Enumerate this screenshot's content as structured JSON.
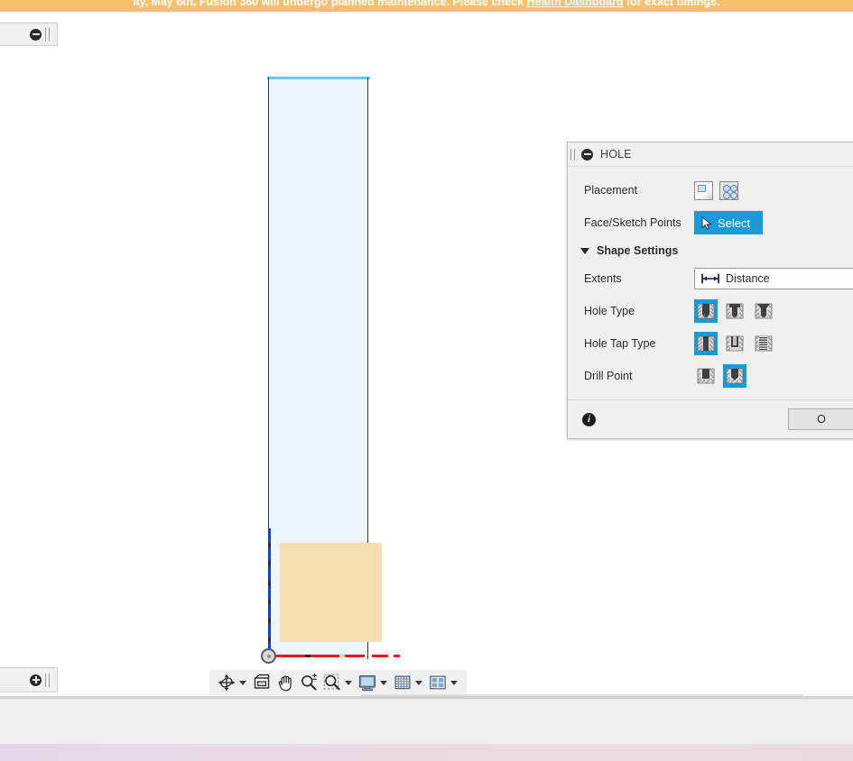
{
  "banner": {
    "text_before": "ay, May 6th, Fusion 360 will undergo planned maintenance. Please check ",
    "link_label": "Health Dashboard",
    "text_after": " for exact timings.",
    "bg_color": "#f8bf6b",
    "text_color": "#ffffff"
  },
  "left_stubs": {
    "top": {
      "icon": "collapse-circle-minus-icon"
    },
    "bottom": {
      "icon": "expand-circle-plus-icon"
    }
  },
  "viewport": {
    "body_fill": "#eef6fc",
    "edge_color": "#3a3a3a",
    "highlight_edge_color": "#6ec6f0",
    "sketch_profile_fill": "#f5dfb0",
    "x_axis_color": "#ec1b1b",
    "y_axis_color": "#1439e8",
    "origin_label": "origin-point"
  },
  "nav_toolbar": {
    "items": [
      {
        "name": "orbit-tool",
        "icon": "orbit-icon",
        "has_dropdown": true
      },
      {
        "name": "look-at-tool",
        "icon": "look-at-icon",
        "has_dropdown": false
      },
      {
        "name": "pan-tool",
        "icon": "hand-pan-icon",
        "has_dropdown": false
      },
      {
        "name": "zoom-tool",
        "icon": "magnifier-plus-minus-icon",
        "has_dropdown": false
      },
      {
        "name": "zoom-window-tool",
        "icon": "magnifier-marquee-icon",
        "has_dropdown": true
      },
      {
        "name": "display-settings",
        "icon": "monitor-icon",
        "has_dropdown": true
      },
      {
        "name": "grid-and-snaps",
        "icon": "grid-icon",
        "has_dropdown": true
      },
      {
        "name": "viewports",
        "icon": "viewports-icon",
        "has_dropdown": true
      }
    ]
  },
  "dialog": {
    "title": "HOLE",
    "collapse_icon": "collapse-circle-minus-icon",
    "grip_icon": "drag-grip-icon",
    "placement": {
      "label": "Placement",
      "options": [
        {
          "name": "placement-single-face",
          "icon": "face-point-icon",
          "selected": false
        },
        {
          "name": "placement-multiple-points",
          "icon": "multi-points-icon",
          "selected": false
        }
      ]
    },
    "face_sketch_points": {
      "label": "Face/Sketch Points",
      "button_label": "Select",
      "button_icon": "cursor-arrow-icon",
      "button_color": "#1a9ad9"
    },
    "shape_settings": {
      "label": "Shape Settings",
      "expanded": true
    },
    "extents": {
      "label": "Extents",
      "value": "Distance",
      "icon": "distance-measure-icon"
    },
    "hole_type": {
      "label": "Hole Type",
      "options": [
        {
          "name": "hole-type-simple",
          "icon": "simple-hole-icon",
          "selected": true
        },
        {
          "name": "hole-type-counterbore",
          "icon": "counterbore-hole-icon",
          "selected": false
        },
        {
          "name": "hole-type-countersink",
          "icon": "countersink-hole-icon",
          "selected": false
        }
      ]
    },
    "hole_tap_type": {
      "label": "Hole Tap Type",
      "options": [
        {
          "name": "tap-type-simple",
          "icon": "simple-tap-icon",
          "selected": true
        },
        {
          "name": "tap-type-clearance",
          "icon": "clearance-tap-icon",
          "selected": false
        },
        {
          "name": "tap-type-tapped",
          "icon": "tapped-hole-icon",
          "selected": false
        }
      ]
    },
    "drill_point": {
      "label": "Drill Point",
      "options": [
        {
          "name": "drill-point-flat",
          "icon": "flat-drill-point-icon",
          "selected": false
        },
        {
          "name": "drill-point-angle",
          "icon": "angled-drill-point-icon",
          "selected": true
        }
      ]
    },
    "footer": {
      "info_icon": "info-icon",
      "ok_label": "O"
    },
    "accent_color": "#189ad8"
  }
}
